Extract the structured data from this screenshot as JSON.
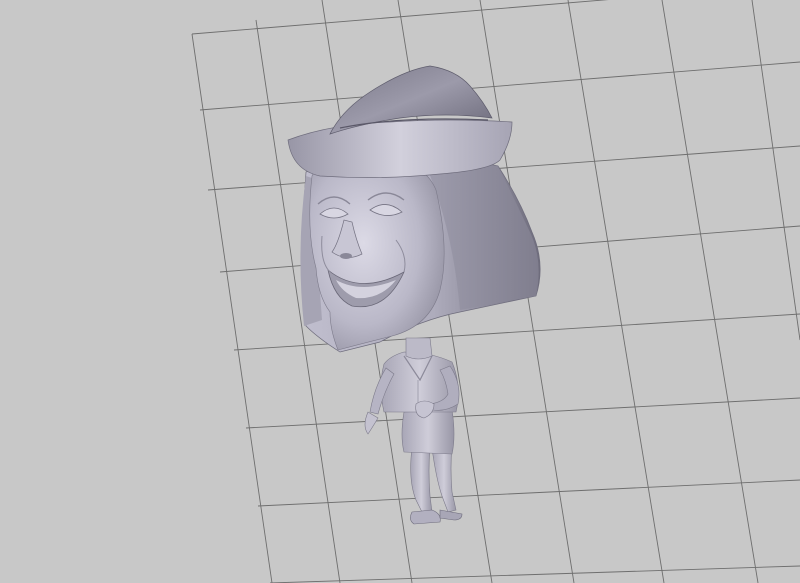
{
  "viewport": {
    "background_color": "#c8c8c8",
    "grid": {
      "visible": true,
      "line_color": "#6e6e6e"
    },
    "model": {
      "icon": "character-model-icon",
      "shading": "flat-gray",
      "base_color": "#b4b1c2",
      "shadow_color": "#6c6a7a",
      "highlight_color": "#dddbe6"
    }
  }
}
